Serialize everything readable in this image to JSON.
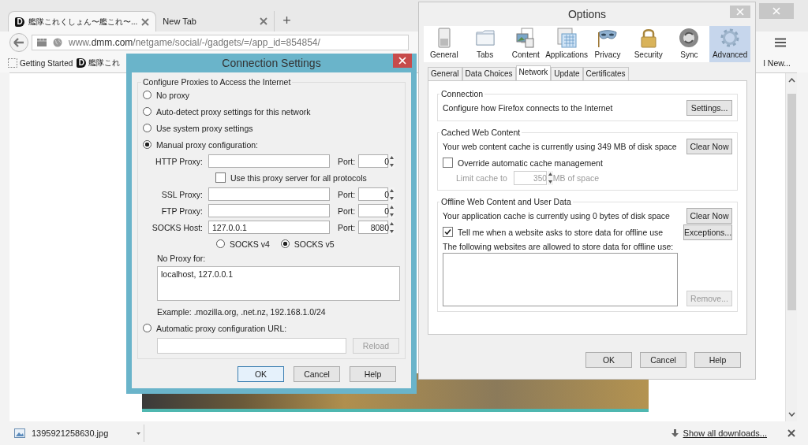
{
  "browser": {
    "tabs": [
      {
        "title": "艦隊これくしょん〜艦これ〜...",
        "favicon": "D",
        "selected": true
      },
      {
        "title": "New Tab",
        "selected": false
      }
    ],
    "new_tab": "+",
    "url": "www.**dmm.com**/netgame/social/-/gadgets/=/app_id=854854/",
    "bookmarks": [
      {
        "label": "Getting Started",
        "kind": "page"
      },
      {
        "label": "艦隊これ",
        "kind": "favicon",
        "favicon": "D"
      }
    ],
    "bookmark_right": "l New...",
    "download": {
      "file": "1395921258630.jpg",
      "show_all": "Show all downloads..."
    }
  },
  "options": {
    "title": "Options",
    "categories": [
      {
        "label": "General",
        "kind": "switch",
        "selected": false
      },
      {
        "label": "Tabs",
        "kind": "folder",
        "selected": false
      },
      {
        "label": "Content",
        "kind": "picture",
        "selected": false
      },
      {
        "label": "Applications",
        "kind": "grid",
        "selected": false
      },
      {
        "label": "Privacy",
        "kind": "mask",
        "selected": false
      },
      {
        "label": "Security",
        "kind": "padlock",
        "selected": false
      },
      {
        "label": "Sync",
        "kind": "sync",
        "selected": false
      },
      {
        "label": "Advanced",
        "kind": "gear",
        "selected": true
      }
    ],
    "subtabs": [
      {
        "label": "General",
        "selected": false
      },
      {
        "label": "Data Choices",
        "selected": false
      },
      {
        "label": "Network",
        "selected": true
      },
      {
        "label": "Update",
        "selected": false
      },
      {
        "label": "Certificates",
        "selected": false
      }
    ],
    "connection": {
      "title": "Connection",
      "text": "Configure how Firefox connects to the Internet",
      "button": "Settings..."
    },
    "cache": {
      "title": "Cached Web Content",
      "text": "Your web content cache is currently using 349 MB of disk space",
      "button": "Clear Now",
      "override": {
        "label": "Override automatic cache management",
        "checked": false
      },
      "limit": {
        "label": "Limit cache to",
        "value": "350",
        "unit": "MB of space",
        "disabled": true
      }
    },
    "offline": {
      "title": "Offline Web Content and User Data",
      "text": "Your application cache is currently using 0 bytes of disk space",
      "button": "Clear Now",
      "notify": {
        "label": "Tell me when a website asks to store data for offline use",
        "checked": true
      },
      "exceptions": "Exceptions...",
      "list_label": "The following websites are allowed to store data for offline use:",
      "remove": {
        "label": "Remove...",
        "disabled": true
      }
    },
    "buttons": [
      "OK",
      "Cancel",
      "Help"
    ]
  },
  "connection_settings": {
    "title": "Connection Settings",
    "group_title": "Configure Proxies to Access the Internet",
    "modes": [
      {
        "label": "No proxy",
        "selected": false
      },
      {
        "label": "Auto-detect proxy settings for this network",
        "selected": false
      },
      {
        "label": "Use system proxy settings",
        "selected": false
      },
      {
        "label": "Manual proxy configuration:",
        "selected": true
      }
    ],
    "proxies": [
      {
        "label": "HTTP Proxy:",
        "port_label": "Port:",
        "port": "0"
      },
      {
        "label": "SSL Proxy:",
        "port_label": "Port:",
        "port": "0"
      },
      {
        "label": "FTP Proxy:",
        "port_label": "Port:",
        "port": "0"
      },
      {
        "label": "SOCKS Host:",
        "host": "127.0.0.1",
        "port_label": "Port:",
        "port": "8080"
      }
    ],
    "share": {
      "label": "Use this proxy server for all protocols",
      "checked": false
    },
    "socks_versions": [
      {
        "label": "SOCKS v4",
        "selected": false
      },
      {
        "label": "SOCKS v5",
        "selected": true
      }
    ],
    "no_proxy": {
      "label": "No Proxy for:",
      "value": "localhost, 127.0.0.1"
    },
    "example": "Example: .mozilla.org, .net.nz, 192.168.1.0/24",
    "auto": {
      "label": "Automatic proxy configuration URL:",
      "selected": false,
      "reload": {
        "label": "Reload",
        "disabled": true
      }
    },
    "buttons": [
      {
        "label": "OK",
        "default": true
      },
      {
        "label": "Cancel",
        "default": false
      },
      {
        "label": "Help",
        "default": false
      }
    ]
  }
}
